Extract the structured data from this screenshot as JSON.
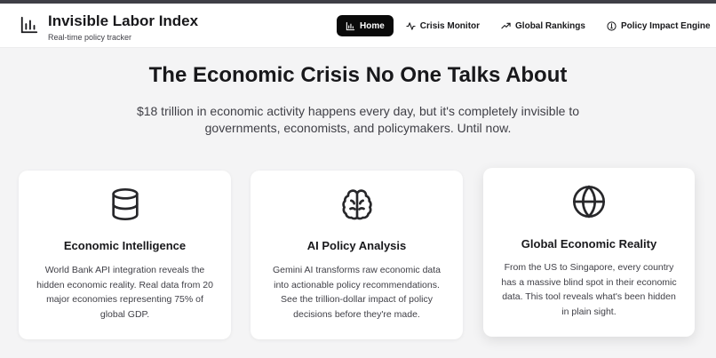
{
  "app": {
    "title": "Invisible Labor Index",
    "subtitle": "Real-time policy tracker",
    "brand_icon": "bar-chart-icon"
  },
  "nav": {
    "items": [
      {
        "label": "Home",
        "icon": "bar-chart-icon",
        "active": true
      },
      {
        "label": "Crisis Monitor",
        "icon": "activity-icon",
        "active": false
      },
      {
        "label": "Global Rankings",
        "icon": "trending-up-icon",
        "active": false
      },
      {
        "label": "Policy Impact Engine",
        "icon": "lightbulb-icon",
        "active": false
      }
    ]
  },
  "hero": {
    "title": "The Economic Crisis No One Talks About",
    "subtitle": "$18 trillion in economic activity happens every day, but it's completely invisible to governments, economists, and policymakers. Until now."
  },
  "cards": [
    {
      "icon": "database-icon",
      "title": "Economic Intelligence",
      "text": "World Bank API integration reveals the hidden economic reality. Real data from 20 major economies representing 75% of global GDP."
    },
    {
      "icon": "brain-icon",
      "title": "AI Policy Analysis",
      "text": "Gemini AI transforms raw economic data into actionable policy recommendations. See the trillion-dollar impact of policy decisions before they're made."
    },
    {
      "icon": "globe-icon",
      "title": "Global Economic Reality",
      "text": "From the US to Singapore, every country has a massive blind spot in their economic data. This tool reveals what's been hidden in plain sight."
    }
  ],
  "colors": {
    "accent": "#0a0a0a",
    "text": "#18181b",
    "muted": "#3f3f46",
    "background": "#f4f4f5"
  }
}
